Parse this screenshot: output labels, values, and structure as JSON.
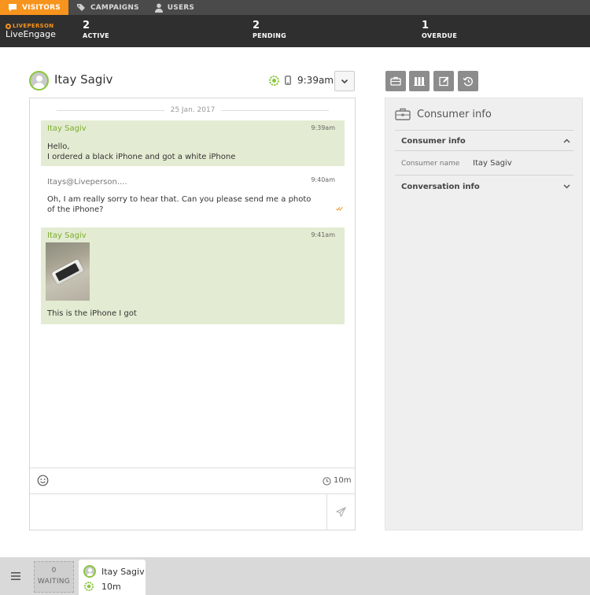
{
  "tabs": [
    {
      "label": "VISITORS",
      "icon": "chat-bubble-icon",
      "active": true
    },
    {
      "label": "CAMPAIGNS",
      "icon": "tag-icon",
      "active": false
    },
    {
      "label": "USERS",
      "icon": "user-icon",
      "active": false
    }
  ],
  "brand": {
    "top": "LIVEPERSON",
    "name": "LiveEngage",
    "accent": "#f7941d"
  },
  "stats": {
    "active": {
      "count": "2",
      "label": "ACTIVE"
    },
    "pending": {
      "count": "2",
      "label": "PENDING"
    },
    "overdue": {
      "count": "1",
      "label": "OVERDUE"
    }
  },
  "conversation": {
    "visitor_name": "Itay Sagiv",
    "time": "9:39am",
    "status_icon": "online-status-icon",
    "device_icon": "mobile-device-icon",
    "date": "25 Jan. 2017",
    "messages": [
      {
        "sender": "Itay Sagiv",
        "time": "9:39am",
        "line1": "Hello,",
        "line2": "I ordered a black iPhone and got a white iPhone"
      },
      {
        "sender": "Itays@Liveperson....",
        "time": "9:40am",
        "line1": "Oh, I am really sorry to hear that. Can you please send me a photo",
        "line2": "of the iPhone?"
      },
      {
        "sender": "Itay Sagiv",
        "time": "9:41am",
        "text": "This is the iPhone I got"
      }
    ],
    "elapsed": "10m"
  },
  "side_panel": {
    "title": "Consumer info",
    "sections": [
      {
        "title": "Consumer info",
        "expanded": true
      },
      {
        "title": "Conversation info",
        "expanded": false
      }
    ],
    "field_label": "Consumer name",
    "field_value": "Itay Sagiv"
  },
  "bottom": {
    "waiting_count": "0",
    "waiting_label": "WAITING",
    "session_name": "Itay Sagiv",
    "session_time": "10m"
  },
  "colors": {
    "consumer_bubble": "#e3ecd2",
    "consumer_name": "#7cab2c",
    "online_green": "#8cc63f"
  }
}
